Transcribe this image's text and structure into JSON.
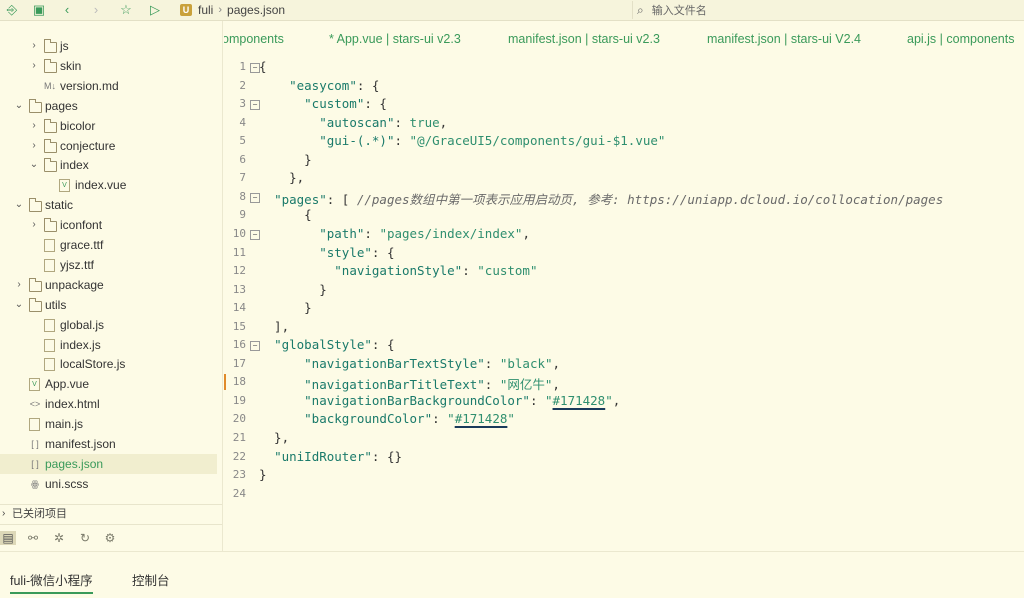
{
  "toolbar": {
    "icons": [
      "new-file-icon",
      "save-icon",
      "back-icon",
      "forward-icon",
      "star-icon",
      "run-icon"
    ],
    "breadcrumb": [
      "fuli",
      "pages.json"
    ],
    "project_badge": "U",
    "search_placeholder": "输入文件名"
  },
  "tree": [
    {
      "indent": 2,
      "type": "folder",
      "collapsed": true,
      "label": "js"
    },
    {
      "indent": 2,
      "type": "folder",
      "collapsed": true,
      "label": "skin"
    },
    {
      "indent": 2,
      "type": "md",
      "label": "version.md"
    },
    {
      "indent": 1,
      "type": "folder",
      "collapsed": false,
      "label": "pages"
    },
    {
      "indent": 2,
      "type": "folder",
      "collapsed": true,
      "label": "bicolor"
    },
    {
      "indent": 2,
      "type": "folder",
      "collapsed": true,
      "label": "conjecture"
    },
    {
      "indent": 2,
      "type": "folder",
      "collapsed": false,
      "label": "index"
    },
    {
      "indent": 3,
      "type": "vue",
      "label": "index.vue"
    },
    {
      "indent": 1,
      "type": "folder",
      "collapsed": false,
      "label": "static"
    },
    {
      "indent": 2,
      "type": "folder",
      "collapsed": true,
      "label": "iconfont"
    },
    {
      "indent": 2,
      "type": "file",
      "label": "grace.ttf"
    },
    {
      "indent": 2,
      "type": "file",
      "label": "yjsz.ttf"
    },
    {
      "indent": 1,
      "type": "folder",
      "collapsed": true,
      "label": "unpackage"
    },
    {
      "indent": 1,
      "type": "folder",
      "collapsed": false,
      "label": "utils"
    },
    {
      "indent": 2,
      "type": "file",
      "label": "global.js"
    },
    {
      "indent": 2,
      "type": "file",
      "label": "index.js"
    },
    {
      "indent": 2,
      "type": "file",
      "label": "localStore.js"
    },
    {
      "indent": 1,
      "type": "vue",
      "label": "App.vue"
    },
    {
      "indent": 1,
      "type": "html",
      "label": "index.html"
    },
    {
      "indent": 1,
      "type": "file",
      "label": "main.js"
    },
    {
      "indent": 1,
      "type": "json",
      "label": "manifest.json"
    },
    {
      "indent": 1,
      "type": "json",
      "label": "pages.json",
      "selected": true
    },
    {
      "indent": 1,
      "type": "scss",
      "label": "uni.scss"
    }
  ],
  "closed_projects": "已关闭项目",
  "tabs": [
    "omponents",
    "* App.vue | stars-ui v2.3",
    "manifest.json | stars-ui v2.3",
    "manifest.json | stars-ui V2.4",
    "api.js | components"
  ],
  "code_lines": [
    "{",
    "    \"easycom\": {",
    "      \"custom\": {",
    "        \"autoscan\": true,",
    "        \"gui-(.*)\": \"@/GraceUI5/components/gui-$1.vue\"",
    "      }",
    "    },",
    "  \"pages\": [ //pages数组中第一项表示应用启动页, 参考: https://uniapp.dcloud.io/collocation/pages",
    "      {",
    "        \"path\": \"pages/index/index\",",
    "        \"style\": {",
    "          \"navigationStyle\": \"custom\"",
    "        }",
    "      }",
    "  ],",
    "  \"globalStyle\": {",
    "      \"navigationBarTextStyle\": \"black\",",
    "      \"navigationBarTitleText\": \"网亿牛\",",
    "      \"navigationBarBackgroundColor\": \"#171428\",",
    "      \"backgroundColor\": \"#171428\"",
    "  },",
    "  \"uniIdRouter\": {}",
    "}",
    ""
  ],
  "bottom_tabs": [
    "fuli-微信小程序",
    "控制台"
  ],
  "colors": {
    "accent": "#3a9a5a",
    "background": "#fdfbe6",
    "string": "#2f8f6f",
    "comment": "#6a6a6a",
    "change_marker": "#e08a2a"
  }
}
